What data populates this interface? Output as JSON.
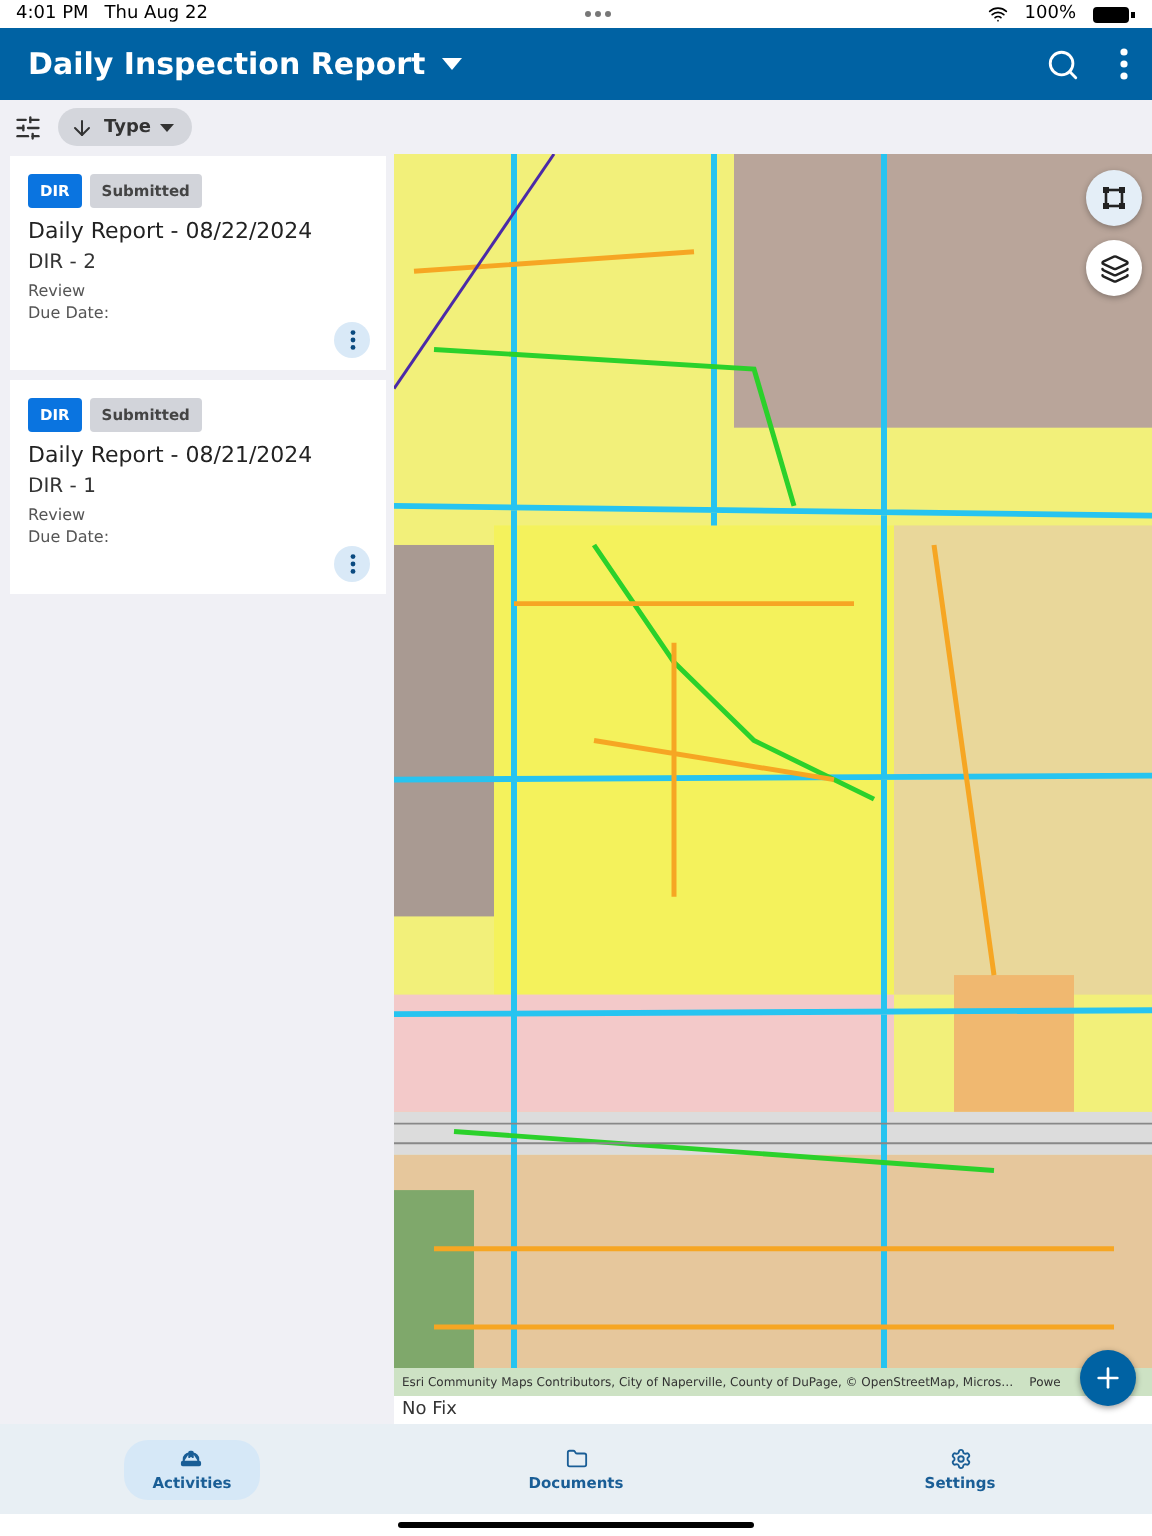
{
  "status_bar": {
    "time": "4:01 PM",
    "date": "Thu Aug 22",
    "battery": "100%"
  },
  "header": {
    "title": "Daily Inspection Report"
  },
  "toolbar": {
    "sort_label": "Type"
  },
  "reports": [
    {
      "type_badge": "DIR",
      "status_badge": "Submitted",
      "title": "Daily Report - 08/22/2024",
      "subtitle": "DIR - 2",
      "stage": "Review",
      "due_label": "Due Date:"
    },
    {
      "type_badge": "DIR",
      "status_badge": "Submitted",
      "title": "Daily Report - 08/21/2024",
      "subtitle": "DIR - 1",
      "stage": "Review",
      "due_label": "Due Date:"
    }
  ],
  "map": {
    "attribution": "Esri Community Maps Contributors, City of Naperville, County of DuPage, © OpenStreetMap, Micros…",
    "powered_by": "Powe",
    "gps_status": "No Fix"
  },
  "nav": [
    {
      "label": "Activities",
      "kind": "activities",
      "selected": true
    },
    {
      "label": "Documents",
      "kind": "documents",
      "selected": false
    },
    {
      "label": "Settings",
      "kind": "settings",
      "selected": false
    }
  ]
}
